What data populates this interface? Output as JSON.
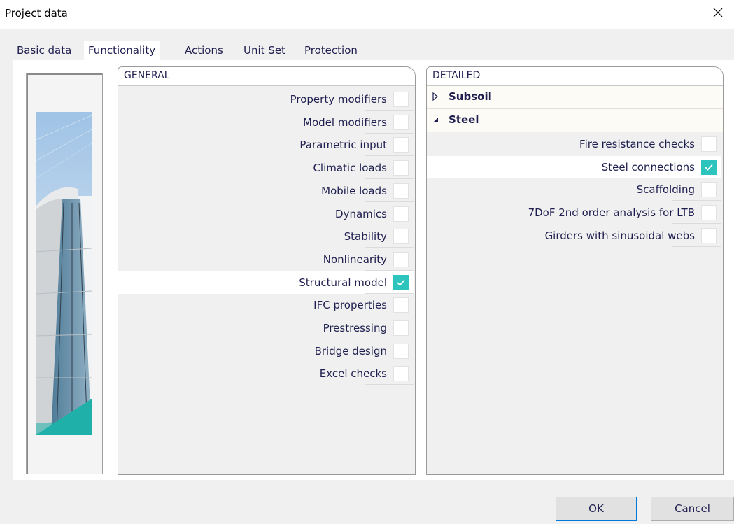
{
  "window": {
    "title": "Project data",
    "close_icon": "close-icon"
  },
  "tabs": [
    {
      "label": "Basic data",
      "active": false
    },
    {
      "label": "Functionality",
      "active": true
    },
    {
      "label": "Actions",
      "active": false
    },
    {
      "label": "Unit Set",
      "active": false
    },
    {
      "label": "Protection",
      "active": false
    }
  ],
  "general": {
    "header": "GENERAL",
    "items": [
      {
        "label": "Property modifiers",
        "checked": false
      },
      {
        "label": "Model modifiers",
        "checked": false
      },
      {
        "label": "Parametric input",
        "checked": false
      },
      {
        "label": "Climatic loads",
        "checked": false
      },
      {
        "label": "Mobile loads",
        "checked": false
      },
      {
        "label": "Dynamics",
        "checked": false
      },
      {
        "label": "Stability",
        "checked": false
      },
      {
        "label": "Nonlinearity",
        "checked": false
      },
      {
        "label": "Structural model",
        "checked": true
      },
      {
        "label": "IFC properties",
        "checked": false
      },
      {
        "label": "Prestressing",
        "checked": false
      },
      {
        "label": "Bridge design",
        "checked": false
      },
      {
        "label": "Excel checks",
        "checked": false
      }
    ]
  },
  "detailed": {
    "header": "DETAILED",
    "groups": [
      {
        "label": "Subsoil",
        "expanded": false,
        "icon": "triangle-right-icon"
      },
      {
        "label": "Steel",
        "expanded": true,
        "icon": "triangle-down-icon"
      }
    ],
    "items": [
      {
        "label": "Fire resistance checks",
        "checked": false
      },
      {
        "label": "Steel connections",
        "checked": true
      },
      {
        "label": "Scaffolding",
        "checked": false
      },
      {
        "label": "7DoF 2nd order analysis for LTB",
        "checked": false
      },
      {
        "label": "Girders with sinusoidal webs",
        "checked": false
      }
    ]
  },
  "buttons": {
    "ok": "OK",
    "cancel": "Cancel"
  },
  "colors": {
    "accent": "#2cc4bd",
    "text": "#1f1f4f",
    "ok_border": "#0078d7"
  }
}
